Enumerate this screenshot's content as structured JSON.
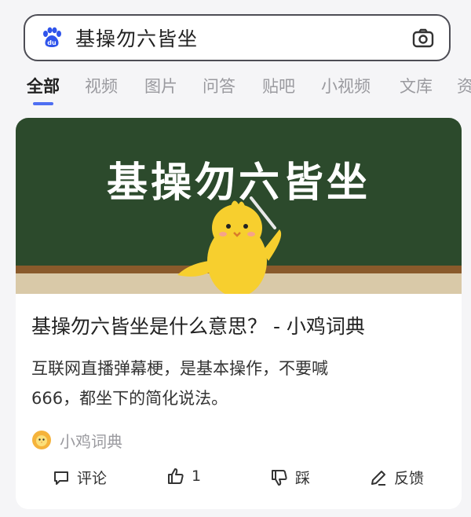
{
  "search": {
    "query": "基操勿六皆坐",
    "logo_icon": "baidu-paw-icon",
    "camera_icon": "camera-icon"
  },
  "tabs": [
    {
      "label": "全部",
      "active": true
    },
    {
      "label": "视频"
    },
    {
      "label": "图片"
    },
    {
      "label": "问答"
    },
    {
      "label": "贴吧"
    },
    {
      "label": "小视频"
    },
    {
      "label": "文库"
    },
    {
      "label": "资"
    }
  ],
  "result": {
    "image_text": "基操勿六皆坐",
    "title": "基操勿六皆坐是什么意思？ - 小鸡词典",
    "snippet_line1": "互联网直播弹幕梗，是基本操作，不要喊",
    "snippet_line2": "666，都坐下的简化说法。",
    "source_name": "小鸡词典",
    "actions": {
      "comment": "评论",
      "like": "1",
      "dislike": "踩",
      "feedback": "反馈"
    }
  },
  "colors": {
    "accent": "#4e6ef2",
    "chalkboard": "#2c4a2c",
    "chick": "#f7cf2e"
  }
}
